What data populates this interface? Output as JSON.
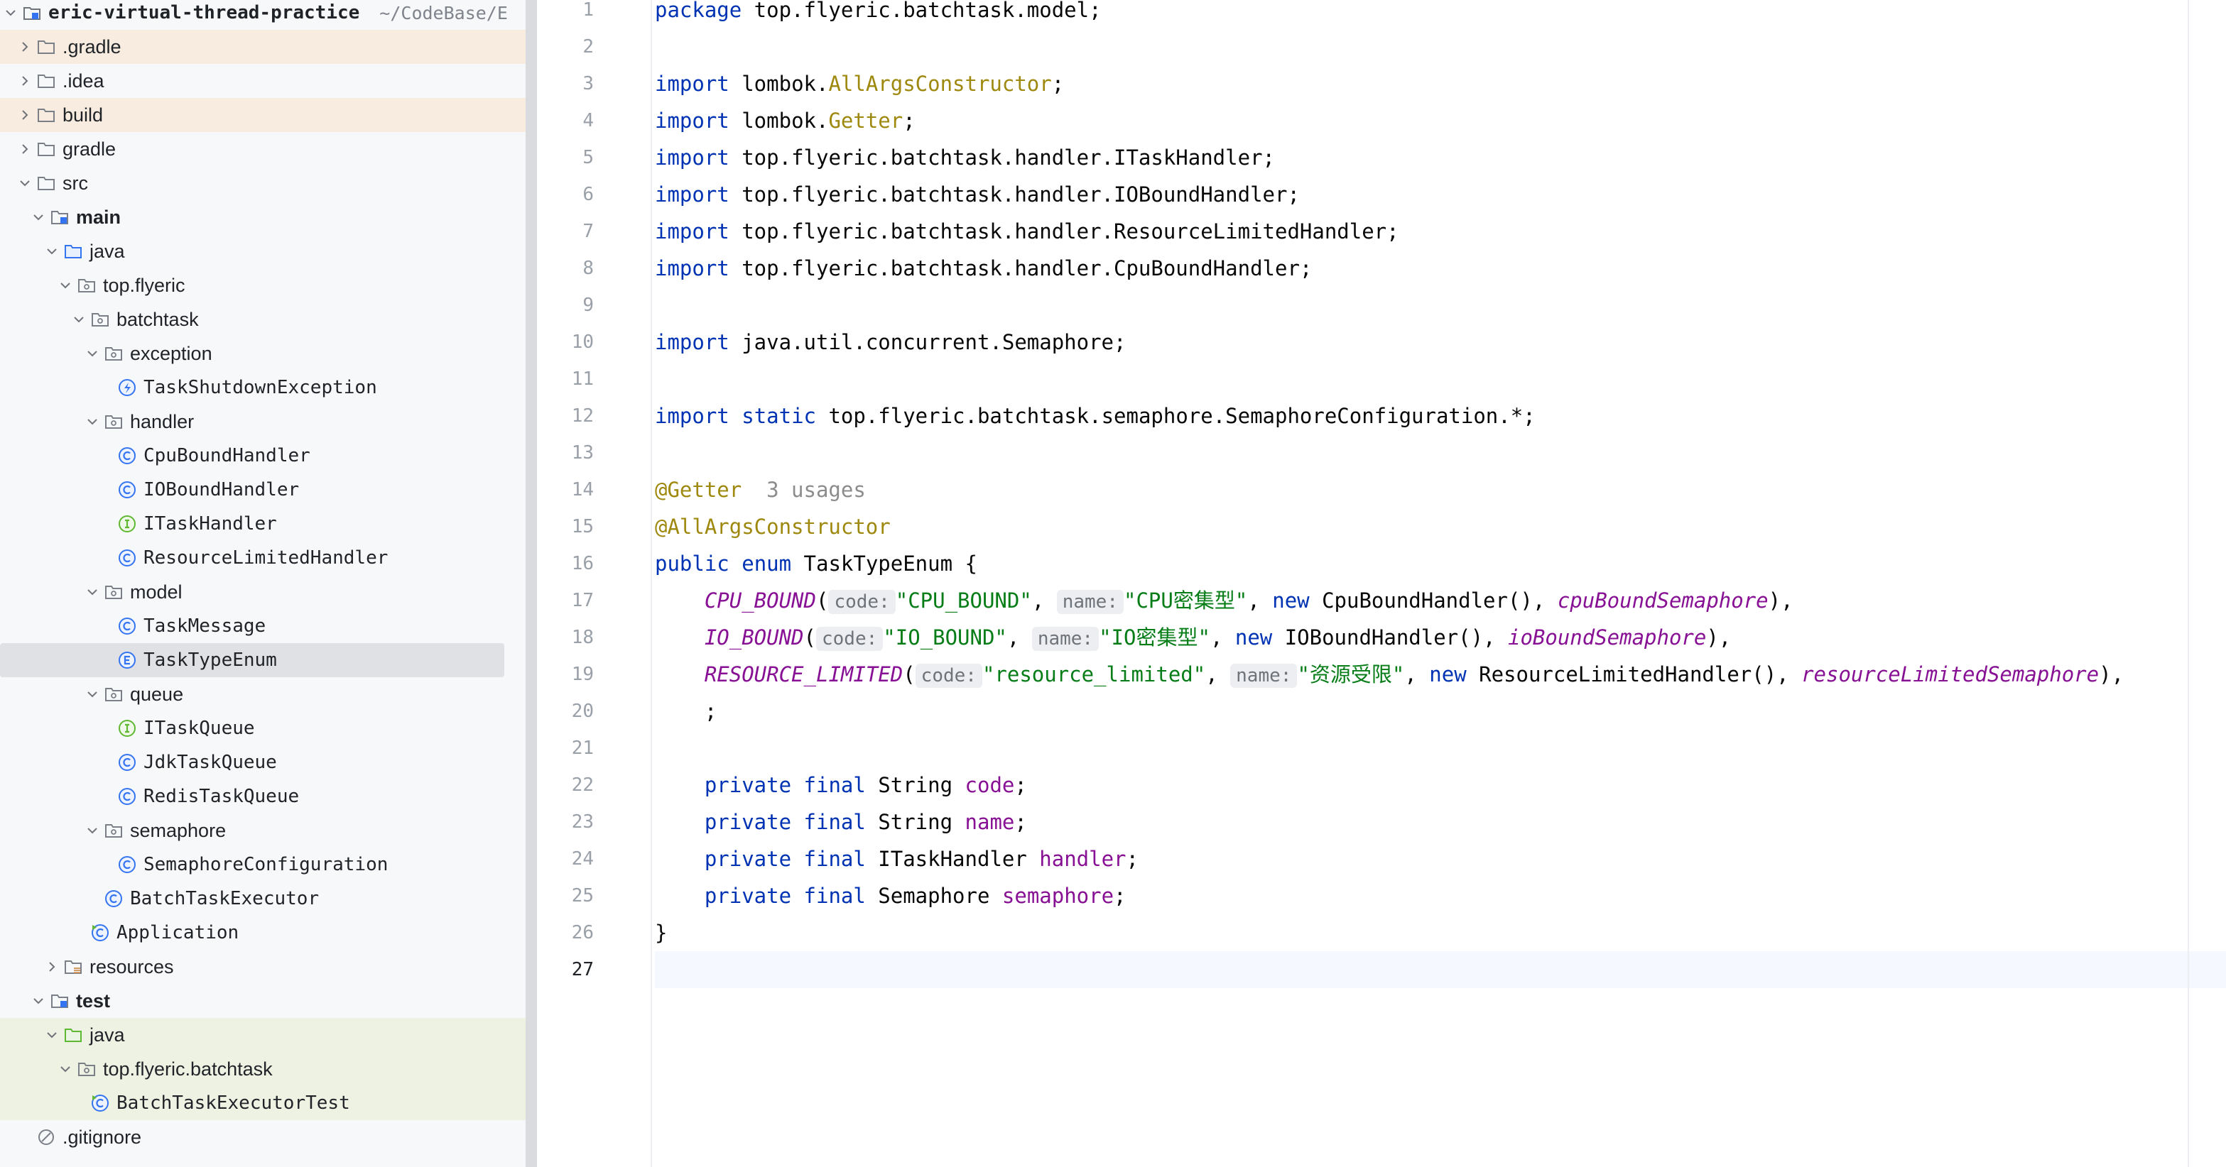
{
  "tree": {
    "root": {
      "name": "eric-virtual-thread-practice",
      "path": "~/CodeBase/E"
    },
    "items": [
      {
        "label": ".gradle",
        "depth": 1,
        "expand": "closed",
        "icon": "folder-icon",
        "hl": "orange"
      },
      {
        "label": ".idea",
        "depth": 1,
        "expand": "closed",
        "icon": "folder-icon",
        "hl": ""
      },
      {
        "label": "build",
        "depth": 1,
        "expand": "closed",
        "icon": "folder-icon",
        "hl": "orange"
      },
      {
        "label": "gradle",
        "depth": 1,
        "expand": "closed",
        "icon": "folder-icon",
        "hl": ""
      },
      {
        "label": "src",
        "depth": 1,
        "expand": "open",
        "icon": "folder-icon",
        "hl": ""
      },
      {
        "label": "main",
        "depth": 2,
        "expand": "open",
        "icon": "module-folder-icon",
        "hl": "",
        "bold": true
      },
      {
        "label": "java",
        "depth": 3,
        "expand": "open",
        "icon": "source-folder-icon",
        "hl": ""
      },
      {
        "label": "top.flyeric",
        "depth": 4,
        "expand": "open",
        "icon": "package-icon",
        "hl": ""
      },
      {
        "label": "batchtask",
        "depth": 5,
        "expand": "open",
        "icon": "package-icon",
        "hl": ""
      },
      {
        "label": "exception",
        "depth": 6,
        "expand": "open",
        "icon": "package-icon",
        "hl": ""
      },
      {
        "label": "TaskShutdownException",
        "depth": 7,
        "expand": "none",
        "icon": "exception-class-icon",
        "hl": "",
        "mono": true
      },
      {
        "label": "handler",
        "depth": 6,
        "expand": "open",
        "icon": "package-icon",
        "hl": ""
      },
      {
        "label": "CpuBoundHandler",
        "depth": 7,
        "expand": "none",
        "icon": "class-icon",
        "hl": "",
        "mono": true
      },
      {
        "label": "IOBoundHandler",
        "depth": 7,
        "expand": "none",
        "icon": "class-icon",
        "hl": "",
        "mono": true
      },
      {
        "label": "ITaskHandler",
        "depth": 7,
        "expand": "none",
        "icon": "interface-icon",
        "hl": "",
        "mono": true
      },
      {
        "label": "ResourceLimitedHandler",
        "depth": 7,
        "expand": "none",
        "icon": "class-icon",
        "hl": "",
        "mono": true
      },
      {
        "label": "model",
        "depth": 6,
        "expand": "open",
        "icon": "package-icon",
        "hl": ""
      },
      {
        "label": "TaskMessage",
        "depth": 7,
        "expand": "none",
        "icon": "class-icon",
        "hl": "",
        "mono": true
      },
      {
        "label": "TaskTypeEnum",
        "depth": 7,
        "expand": "none",
        "icon": "enum-icon",
        "hl": "",
        "mono": true,
        "selected": true
      },
      {
        "label": "queue",
        "depth": 6,
        "expand": "open",
        "icon": "package-icon",
        "hl": ""
      },
      {
        "label": "ITaskQueue",
        "depth": 7,
        "expand": "none",
        "icon": "interface-icon",
        "hl": "",
        "mono": true
      },
      {
        "label": "JdkTaskQueue",
        "depth": 7,
        "expand": "none",
        "icon": "class-icon",
        "hl": "",
        "mono": true
      },
      {
        "label": "RedisTaskQueue",
        "depth": 7,
        "expand": "none",
        "icon": "class-icon",
        "hl": "",
        "mono": true
      },
      {
        "label": "semaphore",
        "depth": 6,
        "expand": "open",
        "icon": "package-icon",
        "hl": ""
      },
      {
        "label": "SemaphoreConfiguration",
        "depth": 7,
        "expand": "none",
        "icon": "class-icon",
        "hl": "",
        "mono": true
      },
      {
        "label": "BatchTaskExecutor",
        "depth": 6,
        "expand": "none",
        "icon": "class-icon",
        "hl": "",
        "mono": true
      },
      {
        "label": "Application",
        "depth": 5,
        "expand": "none",
        "icon": "runnable-class-icon",
        "hl": "",
        "mono": true
      },
      {
        "label": "resources",
        "depth": 3,
        "expand": "closed",
        "icon": "resources-folder-icon",
        "hl": ""
      },
      {
        "label": "test",
        "depth": 2,
        "expand": "open",
        "icon": "module-folder-icon",
        "hl": "",
        "bold": true
      },
      {
        "label": "java",
        "depth": 3,
        "expand": "open",
        "icon": "test-folder-icon",
        "hl": "green"
      },
      {
        "label": "top.flyeric.batchtask",
        "depth": 4,
        "expand": "open",
        "icon": "package-icon",
        "hl": "green"
      },
      {
        "label": "BatchTaskExecutorTest",
        "depth": 5,
        "expand": "none",
        "icon": "runnable-class-icon",
        "hl": "green",
        "mono": true
      },
      {
        "label": ".gitignore",
        "depth": 1,
        "expand": "none",
        "icon": "ignore-file-icon",
        "hl": ""
      }
    ]
  },
  "editor": {
    "current_line": 27,
    "lines": [
      [
        [
          "kw",
          "package"
        ],
        [
          "pl",
          " top.flyeric.batchtask.model;"
        ]
      ],
      [],
      [
        [
          "kw",
          "import"
        ],
        [
          "pl",
          " lombok."
        ],
        [
          "ann",
          "AllArgsConstructor"
        ],
        [
          "pl",
          ";"
        ]
      ],
      [
        [
          "kw",
          "import"
        ],
        [
          "pl",
          " lombok."
        ],
        [
          "ann",
          "Getter"
        ],
        [
          "pl",
          ";"
        ]
      ],
      [
        [
          "kw",
          "import"
        ],
        [
          "pl",
          " top.flyeric.batchtask.handler.ITaskHandler;"
        ]
      ],
      [
        [
          "kw",
          "import"
        ],
        [
          "pl",
          " top.flyeric.batchtask.handler.IOBoundHandler;"
        ]
      ],
      [
        [
          "kw",
          "import"
        ],
        [
          "pl",
          " top.flyeric.batchtask.handler.ResourceLimitedHandler;"
        ]
      ],
      [
        [
          "kw",
          "import"
        ],
        [
          "pl",
          " top.flyeric.batchtask.handler.CpuBoundHandler;"
        ]
      ],
      [],
      [
        [
          "kw",
          "import"
        ],
        [
          "pl",
          " java.util.concurrent.Semaphore;"
        ]
      ],
      [],
      [
        [
          "kw",
          "import"
        ],
        [
          "pl",
          " "
        ],
        [
          "kw",
          "static"
        ],
        [
          "pl",
          " top.flyeric.batchtask.semaphore.SemaphoreConfiguration.*;"
        ]
      ],
      [],
      [
        [
          "ann",
          "@Getter"
        ],
        [
          "hint",
          "  3 usages"
        ]
      ],
      [
        [
          "ann",
          "@AllArgsConstructor"
        ]
      ],
      [
        [
          "kw",
          "public"
        ],
        [
          "pl",
          " "
        ],
        [
          "kw",
          "enum"
        ],
        [
          "pl",
          " TaskTypeEnum {"
        ]
      ],
      [
        [
          "pl",
          "    "
        ],
        [
          "enumc",
          "CPU_BOUND"
        ],
        [
          "pl",
          "("
        ],
        [
          "inlay",
          "code:"
        ],
        [
          "str",
          "\"CPU_BOUND\""
        ],
        [
          "pl",
          ", "
        ],
        [
          "inlay",
          "name:"
        ],
        [
          "str",
          "\"CPU密集型\""
        ],
        [
          "pl",
          ", "
        ],
        [
          "kw",
          "new"
        ],
        [
          "pl",
          " CpuBoundHandler(), "
        ],
        [
          "enumc",
          "cpuBoundSemaphore"
        ],
        [
          "pl",
          "),"
        ]
      ],
      [
        [
          "pl",
          "    "
        ],
        [
          "enumc",
          "IO_BOUND"
        ],
        [
          "pl",
          "("
        ],
        [
          "inlay",
          "code:"
        ],
        [
          "str",
          "\"IO_BOUND\""
        ],
        [
          "pl",
          ", "
        ],
        [
          "inlay",
          "name:"
        ],
        [
          "str",
          "\"IO密集型\""
        ],
        [
          "pl",
          ", "
        ],
        [
          "kw",
          "new"
        ],
        [
          "pl",
          " IOBoundHandler(), "
        ],
        [
          "enumc",
          "ioBoundSemaphore"
        ],
        [
          "pl",
          "),"
        ]
      ],
      [
        [
          "pl",
          "    "
        ],
        [
          "enumc",
          "RESOURCE_LIMITED"
        ],
        [
          "pl",
          "("
        ],
        [
          "inlay",
          "code:"
        ],
        [
          "str",
          "\"resource_limited\""
        ],
        [
          "pl",
          ", "
        ],
        [
          "inlay",
          "name:"
        ],
        [
          "str",
          "\"资源受限\""
        ],
        [
          "pl",
          ", "
        ],
        [
          "kw",
          "new"
        ],
        [
          "pl",
          " ResourceLimitedHandler(), "
        ],
        [
          "enumc",
          "resourceLimitedSemaphore"
        ],
        [
          "pl",
          "),"
        ]
      ],
      [
        [
          "pl",
          "    ;"
        ]
      ],
      [],
      [
        [
          "pl",
          "    "
        ],
        [
          "kw",
          "private"
        ],
        [
          "pl",
          " "
        ],
        [
          "kw",
          "final"
        ],
        [
          "pl",
          " String "
        ],
        [
          "field",
          "code"
        ],
        [
          "pl",
          ";"
        ]
      ],
      [
        [
          "pl",
          "    "
        ],
        [
          "kw",
          "private"
        ],
        [
          "pl",
          " "
        ],
        [
          "kw",
          "final"
        ],
        [
          "pl",
          " String "
        ],
        [
          "field",
          "name"
        ],
        [
          "pl",
          ";"
        ]
      ],
      [
        [
          "pl",
          "    "
        ],
        [
          "kw",
          "private"
        ],
        [
          "pl",
          " "
        ],
        [
          "kw",
          "final"
        ],
        [
          "pl",
          " ITaskHandler "
        ],
        [
          "field",
          "handler"
        ],
        [
          "pl",
          ";"
        ]
      ],
      [
        [
          "pl",
          "    "
        ],
        [
          "kw",
          "private"
        ],
        [
          "pl",
          " "
        ],
        [
          "kw",
          "final"
        ],
        [
          "pl",
          " Semaphore "
        ],
        [
          "field",
          "semaphore"
        ],
        [
          "pl",
          ";"
        ]
      ],
      [
        [
          "pl",
          "}"
        ]
      ],
      []
    ]
  },
  "colors": {
    "folder": "#7b8088",
    "class": "#3574f0",
    "interface": "#5fb832",
    "exception": "#3574f0",
    "excluded_folder": "#d39b63"
  }
}
